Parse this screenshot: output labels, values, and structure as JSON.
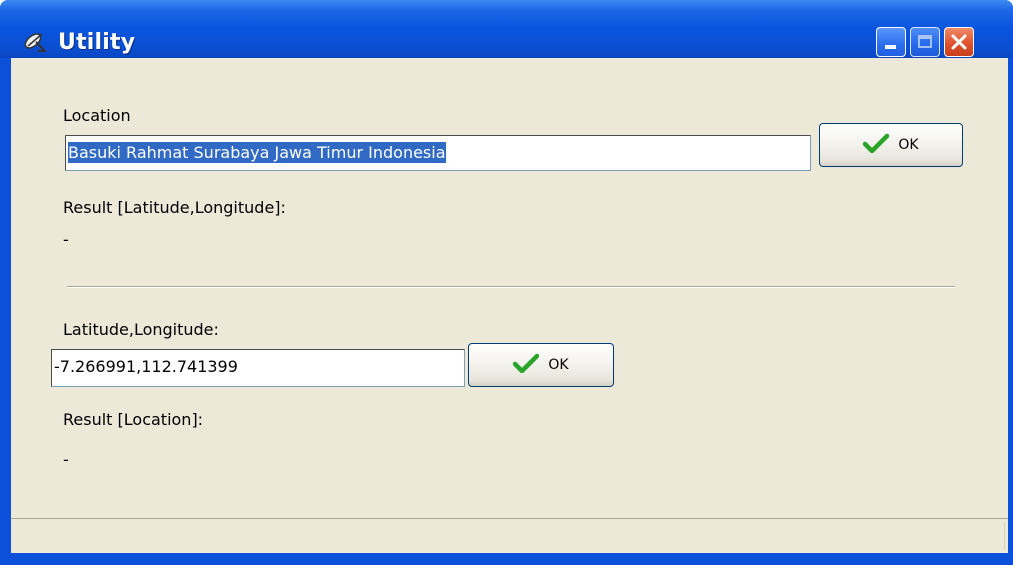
{
  "window": {
    "title": "Utility",
    "icon": "satellite-dish-icon"
  },
  "geocode": {
    "location_label": "Location",
    "location_value": "Basuki Rahmat Surabaya Jawa Timur Indonesia",
    "ok_label": "OK",
    "result_label": "Result [Latitude,Longitude]:",
    "result_value": "-"
  },
  "reverse": {
    "latlng_label": "Latitude,Longitude:",
    "latlng_value": "-7.266991,112.741399",
    "ok_label": "OK",
    "result_label": "Result [Location]:",
    "result_value": "-"
  },
  "colors": {
    "title_bar": "#0a55e0",
    "client_bg": "#ece9d8",
    "selection": "#316ac5",
    "check_green": "#2aa52a"
  }
}
